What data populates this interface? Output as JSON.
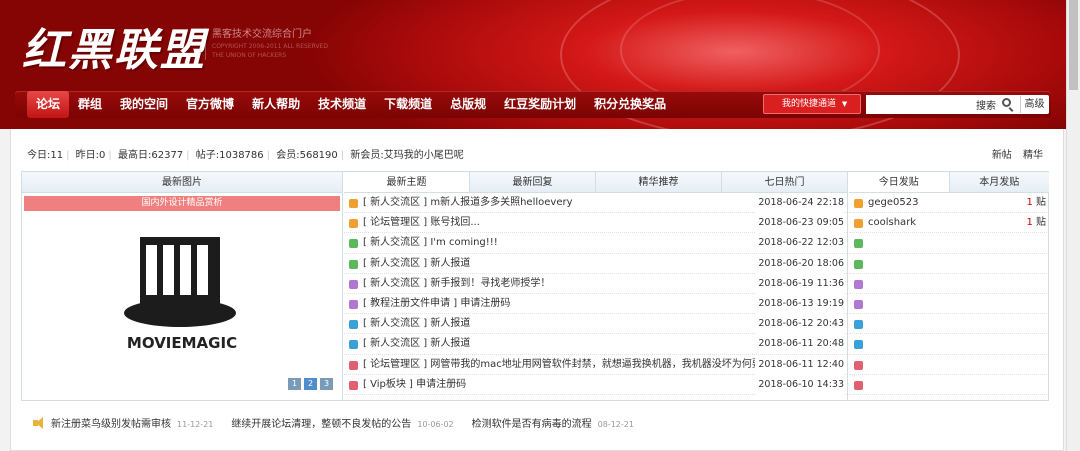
{
  "header": {
    "logo": "红黑联盟",
    "tagline_cn": "黑客技术交流综合门户",
    "tagline_en1": "COPYRIGHT 2006-2011 ALL RESERVED",
    "tagline_en2": "THE UNION OF HACKERS"
  },
  "nav": {
    "items": [
      "论坛",
      "群组",
      "我的空间",
      "官方微博",
      "新人帮助",
      "技术频道",
      "下载频道",
      "总版规",
      "红豆奖励计划",
      "积分兑换奖品"
    ],
    "quick_label": "我的快捷通道",
    "search_label": "搜索",
    "advanced_label": "高级"
  },
  "stats": {
    "today_label": "今日:",
    "today": "11",
    "yesterday_label": "昨日:",
    "yesterday": "0",
    "max_label": "最高日:",
    "max": "62377",
    "posts_label": "帖子:",
    "posts": "1038786",
    "members_label": "会员:",
    "members": "568190",
    "newmember_label": "新会员:",
    "newmember": "艾玛我的小尾巴呢"
  },
  "links": {
    "new": "新帖",
    "digest": "精华"
  },
  "left": {
    "header": "最新图片",
    "banner": "国内外设计精品赏析",
    "image_caption": "MOVIEMAGIC",
    "pages": [
      "1",
      "2",
      "3"
    ]
  },
  "middle": {
    "tabs": [
      "最新主题",
      "最新回复",
      "精华推荐",
      "七日热门"
    ],
    "rows": [
      {
        "title": "[ 新人交流区 ] m新人报道多多关照helloevery",
        "date": "2018-06-24 22:18",
        "color": "#f0a030"
      },
      {
        "title": "[ 论坛管理区 ] 账号找回...",
        "date": "2018-06-23 09:05",
        "color": "#f0a030"
      },
      {
        "title": "[ 新人交流区 ] I'm coming!!!",
        "date": "2018-06-22 12:03",
        "color": "#5cb85c"
      },
      {
        "title": "[ 新人交流区 ] 新人报道",
        "date": "2018-06-20 18:06",
        "color": "#5cb85c"
      },
      {
        "title": "[ 新人交流区 ] 新手报到！寻找老师授学！",
        "date": "2018-06-19 11:36",
        "color": "#b078d0"
      },
      {
        "title": "[ 教程注册文件申请 ] 申请注册码",
        "date": "2018-06-13 19:19",
        "color": "#b078d0"
      },
      {
        "title": "[ 新人交流区 ] 新人报道",
        "date": "2018-06-12 20:43",
        "color": "#3aa0d8"
      },
      {
        "title": "[ 新人交流区 ] 新人报道",
        "date": "2018-06-11 20:48",
        "color": "#3aa0d8"
      },
      {
        "title": "[ 论坛管理区 ] 网管带我的mac地址用网管软件封禁，就想逼我换机器，我机器没坏为何要",
        "date": "2018-06-11 12:40",
        "color": "#e06070"
      },
      {
        "title": "[ Vip板块 ] 申请注册码",
        "date": "2018-06-10 14:33",
        "color": "#e06070"
      }
    ]
  },
  "right": {
    "tabs": [
      "今日发贴",
      "本月发贴"
    ],
    "rows": [
      {
        "name": "gege0523",
        "count": "1",
        "unit": "贴",
        "color": "#f0a030"
      },
      {
        "name": "coolshark",
        "count": "1",
        "unit": "贴",
        "color": "#f0a030"
      },
      {
        "name": "",
        "count": "",
        "unit": "",
        "color": "#5cb85c"
      },
      {
        "name": "",
        "count": "",
        "unit": "",
        "color": "#5cb85c"
      },
      {
        "name": "",
        "count": "",
        "unit": "",
        "color": "#b078d0"
      },
      {
        "name": "",
        "count": "",
        "unit": "",
        "color": "#b078d0"
      },
      {
        "name": "",
        "count": "",
        "unit": "",
        "color": "#3aa0d8"
      },
      {
        "name": "",
        "count": "",
        "unit": "",
        "color": "#3aa0d8"
      },
      {
        "name": "",
        "count": "",
        "unit": "",
        "color": "#e06070"
      },
      {
        "name": "",
        "count": "",
        "unit": "",
        "color": "#e06070"
      }
    ]
  },
  "announcements": [
    {
      "text": "新注册菜鸟级别发帖需审核",
      "date": "11-12-21"
    },
    {
      "text": "继续开展论坛清理，整顿不良发帖的公告",
      "date": "10-06-02"
    },
    {
      "text": "检测软件是否有病毒的流程",
      "date": "08-12-21"
    }
  ]
}
